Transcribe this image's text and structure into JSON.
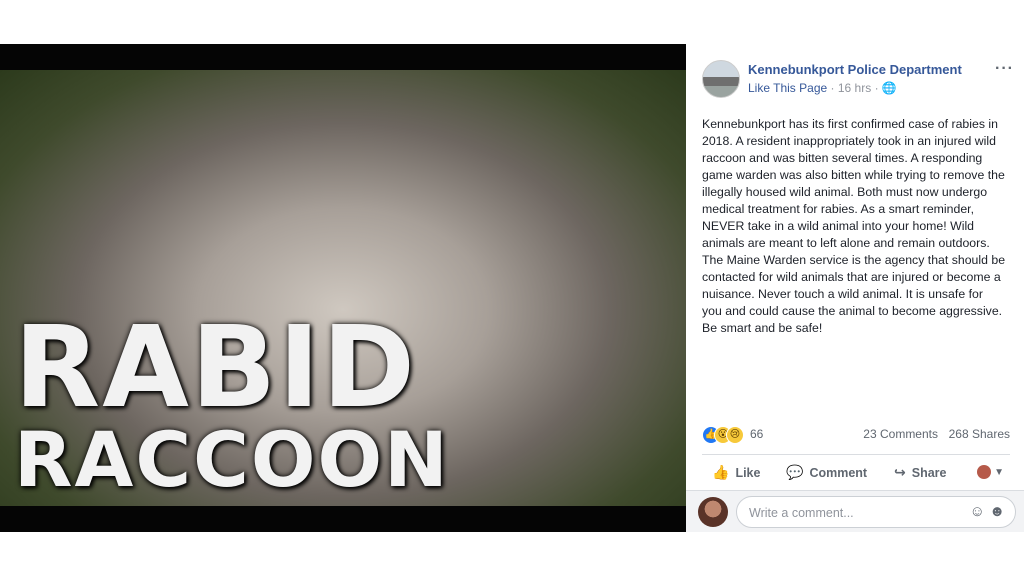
{
  "image": {
    "headline_line1": "RABID",
    "headline_line2": "RACCOON"
  },
  "post": {
    "page_name": "Kennebunkport Police Department",
    "like_page": "Like This Page",
    "time": "16 hrs",
    "more_icon": "···",
    "text": "Kennebunkport has its first confirmed case of rabies in 2018. A resident inappropriately took in an injured wild raccoon and was bitten several times. A responding game warden was also bitten while trying to remove the illegally housed wild animal. Both must now undergo medical treatment for rabies. As a smart reminder, NEVER take in a wild animal into your home! Wild animals are meant to left alone and remain outdoors. The Maine Warden service is the agency that should be contacted for wild animals that are injured or become a nuisance. Never touch a wild animal. It is unsafe for you and could cause the animal to become aggressive. Be smart and be safe!",
    "reaction_count": "66",
    "comments": "23 Comments",
    "shares": "268 Shares"
  },
  "actions": {
    "like": "Like",
    "comment": "Comment",
    "share": "Share"
  },
  "comment_box": {
    "placeholder": "Write a comment..."
  },
  "colors": {
    "link": "#365899",
    "muted": "#90949c",
    "like_blue": "#2078f4"
  }
}
